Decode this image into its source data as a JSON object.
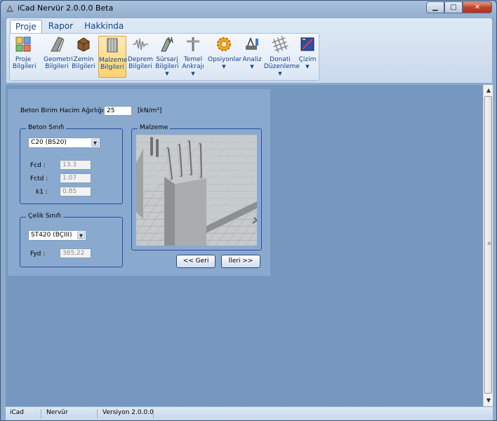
{
  "window": {
    "title": "iCad Nervür 2.0.0.0 Beta"
  },
  "ribbon": {
    "tabs": [
      "Proje",
      "Rapor",
      "Hakkinda"
    ],
    "buttons": [
      {
        "label1": "Proje",
        "label2": "Bilgileri",
        "icon": "project-icon",
        "dropdown": false
      },
      {
        "label1": "Geometri",
        "label2": "Bilgileri",
        "icon": "geometry-icon",
        "dropdown": false
      },
      {
        "label1": "Zemin",
        "label2": "Bilgileri",
        "icon": "soil-icon",
        "dropdown": false
      },
      {
        "label1": "Malzeme",
        "label2": "Bilgileri",
        "icon": "material-icon",
        "dropdown": false
      },
      {
        "label1": "Deprem",
        "label2": "Bilgileri",
        "icon": "earthquake-icon",
        "dropdown": false
      },
      {
        "label1": "Sürsarj",
        "label2": "Bilgileri",
        "icon": "surcharge-icon",
        "dropdown": true
      },
      {
        "label1": "Temel",
        "label2": "Ankrajı",
        "icon": "anchor-icon",
        "dropdown": true
      },
      {
        "label1": "Opsiyonlar",
        "label2": "",
        "icon": "options-gear-icon",
        "dropdown": true
      },
      {
        "label1": "Analiz",
        "label2": "",
        "icon": "analysis-icon",
        "dropdown": true
      },
      {
        "label1": "Donati",
        "label2": "Düzenleme",
        "icon": "rebar-mesh-icon",
        "dropdown": true
      },
      {
        "label1": "Çizim",
        "label2": "",
        "icon": "drawing-icon",
        "dropdown": true
      }
    ]
  },
  "form": {
    "unit_weight_label": "Beton Birim Hacim Ağırlığı :",
    "unit_weight_value": "25",
    "unit_weight_unit": "[kN/m³]",
    "concrete": {
      "title": "Beton Sınıfı",
      "selected": "C20 (BS20)",
      "fcd_label": "Fcd :",
      "fcd_value": "13.3",
      "fctd_label": "Fctd :",
      "fctd_value": "1.07",
      "k1_label": "k1 :",
      "k1_value": "0.85"
    },
    "steel": {
      "title": "Çelik Sınıfı",
      "selected": "ST420 (BÇIII)",
      "fyd_label": "Fyd :",
      "fyd_value": "365,22"
    },
    "material": {
      "title": "Malzeme"
    },
    "back_label": "<< Geri",
    "next_label": "İleri >>"
  },
  "statusbar": {
    "app": "iCad",
    "module": "Nervür",
    "version": "Versiyon 2.0.0.0"
  }
}
